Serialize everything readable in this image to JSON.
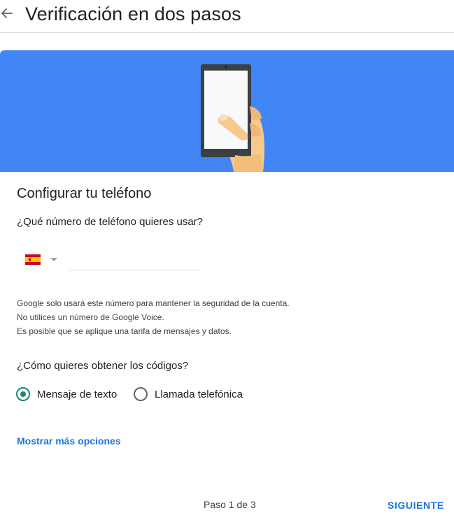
{
  "header": {
    "back_icon": "arrow-left-icon",
    "title": "Verificación en dos pasos"
  },
  "banner": {
    "color": "#4285f4",
    "illustration": "phone-in-hand-illustration"
  },
  "section": {
    "title": "Configurar tu teléfono"
  },
  "phone": {
    "question": "¿Qué número de teléfono quieres usar?",
    "country_flag": "spain-flag-icon",
    "number_value": "",
    "notes": [
      "Google solo usará este número para mantener la seguridad de la cuenta.",
      "No utilices un número de Google Voice.",
      "Es posible que se aplique una tarifa de mensajes y datos."
    ]
  },
  "codes": {
    "question": "¿Cómo quieres obtener los códigos?",
    "options": [
      {
        "label": "Mensaje de texto",
        "selected": true
      },
      {
        "label": "Llamada telefónica",
        "selected": false
      }
    ]
  },
  "more_options_link": "Mostrar más opciones",
  "footer": {
    "step": "Paso 1 de 3",
    "next_label": "SIGUIENTE"
  },
  "colors": {
    "accent": "#1a73e8",
    "radio_selected": "#1a8a6e",
    "banner": "#4285f4"
  }
}
